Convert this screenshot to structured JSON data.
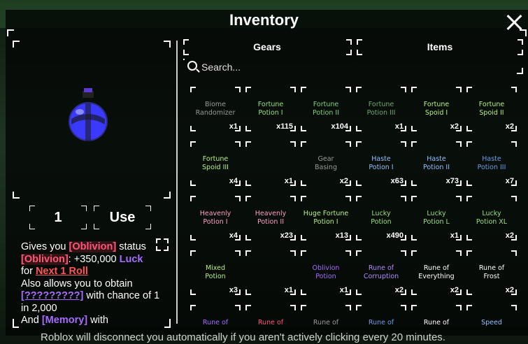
{
  "window": {
    "title": "Inventory"
  },
  "selected": {
    "quantity": "1",
    "use_label": "Use"
  },
  "description": {
    "l1a": "Gives you ",
    "l1b": "[Oblivion]",
    "l1c": " status",
    "l2a": "[Oblivion]",
    "l2b": ": +350,000 ",
    "l2c": "Luck",
    "l3a": "for ",
    "l3b": "Next 1 Roll",
    "l4": "Also allows you to obtain",
    "l5a": "[?????????]",
    "l5b": " with chance of 1",
    "l6": "in 2,000",
    "l7a": "And ",
    "l7b": "[Memory]",
    "l7c": " with"
  },
  "tabs": [
    "Gears",
    "Items"
  ],
  "search": {
    "placeholder": "Search..."
  },
  "items": [
    {
      "name": "Biome\nRandomizer",
      "count": "x1",
      "color": "#9a9a9a"
    },
    {
      "name": "Fortune\nPotion I",
      "count": "x115",
      "color": "#9be07e"
    },
    {
      "name": "Fortune\nPotion II",
      "count": "x104",
      "color": "#7ed27e"
    },
    {
      "name": "Fortune\nPotion III",
      "count": "x1",
      "color": "#6fa86f"
    },
    {
      "name": "Fortune\nSpoid I",
      "count": "x2",
      "color": "#b7f07e"
    },
    {
      "name": "Fortune\nSpoid II",
      "count": "x2",
      "color": "#b7f07e"
    },
    {
      "name": "Fortune\nSpoid III",
      "count": "x4",
      "color": "#b7f07e"
    },
    {
      "name": "",
      "count": "x1",
      "color": "#9a9a9a"
    },
    {
      "name": "Gear\nBasing",
      "count": "x2",
      "color": "#9a9a9a"
    },
    {
      "name": "Haste\nPotion I",
      "count": "x63",
      "color": "#8fc2ff"
    },
    {
      "name": "Haste\nPotion II",
      "count": "x73",
      "color": "#8fc2ff"
    },
    {
      "name": "Haste\nPotion III",
      "count": "x7",
      "color": "#6a9fe8"
    },
    {
      "name": "Heavenly\nPotion I",
      "count": "x4",
      "color": "#ff9fc4"
    },
    {
      "name": "Heavenly\nPotion II",
      "count": "x23",
      "color": "#ff9fc4"
    },
    {
      "name": "Huge Fortune\nPotion I",
      "count": "x13",
      "color": "#b7f07e"
    },
    {
      "name": "Lucky\nPotion",
      "count": "x490",
      "color": "#9be07e"
    },
    {
      "name": "Lucky\nPotion L",
      "count": "x1",
      "color": "#9be07e"
    },
    {
      "name": "Lucky\nPotion XL",
      "count": "x2",
      "color": "#9be07e"
    },
    {
      "name": "Mixed\nPotion",
      "count": "x3",
      "color": "#b7f07e"
    },
    {
      "name": "",
      "count": "x1",
      "color": "#9a9a9a"
    },
    {
      "name": "Oblivion\nPotion",
      "count": "x1",
      "color": "#a66cff"
    },
    {
      "name": "Rune of\nCorruption",
      "count": "x2",
      "color": "#b48cff"
    },
    {
      "name": "Rune of\nEverything",
      "count": "x2",
      "color": "#ffffff"
    },
    {
      "name": "Rune of\nFrost",
      "count": "x2",
      "color": "#ffffff"
    },
    {
      "name": "Rune of",
      "count": "",
      "color": "#a66cff"
    },
    {
      "name": "Rune of",
      "count": "",
      "color": "#ff5577"
    },
    {
      "name": "Rune of",
      "count": "",
      "color": "#9a9a9a"
    },
    {
      "name": "Rune of",
      "count": "",
      "color": "#6a9fe8"
    },
    {
      "name": "Rune of",
      "count": "",
      "color": "#ffffff"
    },
    {
      "name": "Speed",
      "count": "",
      "color": "#8fc2ff"
    }
  ],
  "footer": {
    "text": "Roblox will disconnect you automatically if you aren't actively clicking every 20 minutes."
  },
  "colors": {
    "accent_red": "#ff5577",
    "accent_purple": "#a66cff"
  }
}
